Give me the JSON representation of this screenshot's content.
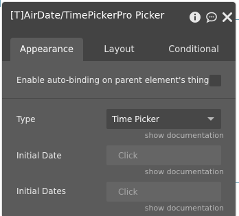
{
  "window": {
    "title": "[T]AirDate/TimePickerPro Picker",
    "icons": [
      "info-icon",
      "comment-icon",
      "close-icon"
    ]
  },
  "tabs": [
    {
      "label": "Appearance",
      "active": true
    },
    {
      "label": "Layout",
      "active": false
    },
    {
      "label": "Conditional",
      "active": false
    }
  ],
  "autobinding": {
    "label": "Enable auto-binding on parent element's thing",
    "checked": false
  },
  "fields": {
    "type": {
      "label": "Type",
      "value": "Time Picker",
      "doc": "show documentation"
    },
    "initial_date": {
      "label": "Initial Date",
      "placeholder": "Click",
      "doc": "show documentation"
    },
    "initial_dates": {
      "label": "Initial Dates",
      "placeholder": "Click",
      "doc": "show documentation"
    }
  },
  "colors": {
    "panel_dark": "#434343",
    "panel_body": "#5b5b5b",
    "input_bg": "#656565",
    "background_line": "#6a9fb5"
  }
}
